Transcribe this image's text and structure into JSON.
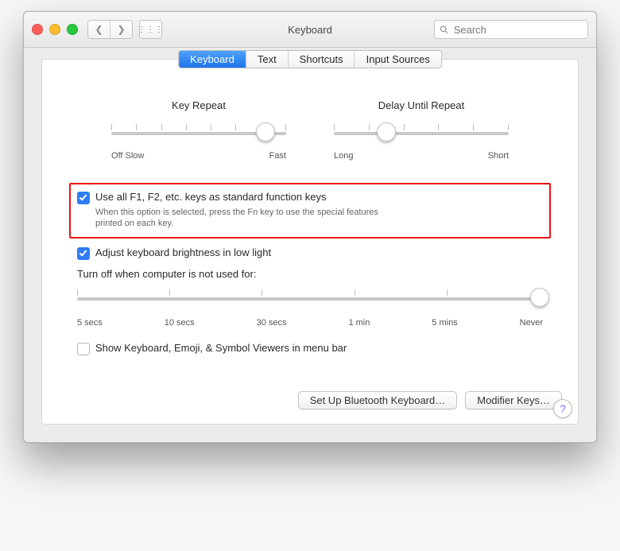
{
  "window": {
    "title": "Keyboard"
  },
  "search": {
    "placeholder": "Search"
  },
  "tabs": {
    "t0": "Keyboard",
    "t1": "Text",
    "t2": "Shortcuts",
    "t3": "Input Sources"
  },
  "sliders": {
    "repeat": {
      "title": "Key Repeat",
      "left": "Off Slow",
      "right": "Fast",
      "ticks": 8,
      "pos": 0.88
    },
    "delay": {
      "title": "Delay Until Repeat",
      "left": "Long",
      "right": "Short",
      "ticks": 6,
      "pos": 0.3
    }
  },
  "options": {
    "fn": {
      "checked": true,
      "label": "Use all F1, F2, etc. keys as standard function keys",
      "help": "When this option is selected, press the Fn key to use the special features printed on each key."
    },
    "brightness": {
      "checked": true,
      "label": "Adjust keyboard brightness in low light"
    },
    "turnoff_label": "Turn off when computer is not used for:",
    "turnoff_ticks": [
      "5 secs",
      "10 secs",
      "30 secs",
      "1 min",
      "5 mins",
      "Never"
    ],
    "turnoff_pos": 1.0,
    "viewers": {
      "checked": false,
      "label": "Show Keyboard, Emoji, & Symbol Viewers in menu bar"
    }
  },
  "buttons": {
    "bluetooth": "Set Up Bluetooth Keyboard…",
    "modifier": "Modifier Keys…"
  }
}
